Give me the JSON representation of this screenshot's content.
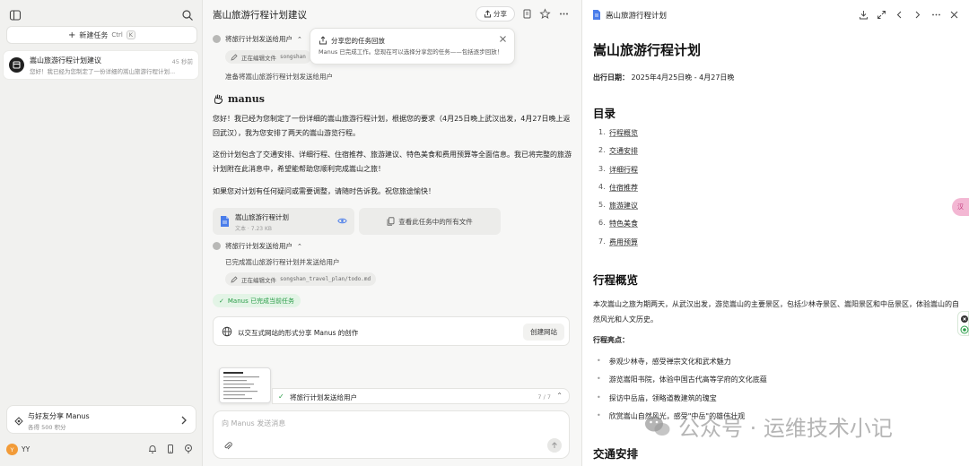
{
  "sidebar": {
    "new_task_label": "新建任务",
    "shortcut_ctrl": "Ctrl",
    "shortcut_key": "K",
    "task": {
      "title": "嵩山旅游行程计划建议",
      "time": "45 秒前",
      "snippet": "您好！我已经为您制定了一份详细的嵩山旅游行程计划..."
    },
    "share": {
      "title": "与好友分享 Manus",
      "subtitle": "各得 500 积分"
    },
    "user": {
      "initial": "Y",
      "name": "YY"
    }
  },
  "chat": {
    "title": "嵩山旅游行程计划建议",
    "share_label": "分享",
    "step1": {
      "label": "将旅行计划发送给用户",
      "chip_prefix": "正在编辑文件",
      "chip_path": "songshan",
      "note": "准备将嵩山旅游行程计划发送给用户"
    },
    "notification": {
      "title": "分享您的任务回放",
      "body": "Manus 已完成工作。您现在可以选择分享您的任务——包括逐步回放！"
    },
    "brand": "manus",
    "paragraphs": [
      "您好！我已经为您制定了一份详细的嵩山旅游行程计划，根据您的要求（4月25日晚上武汉出发，4月27日晚上返回武汉），我为您安排了两天的嵩山游览行程。",
      "这份计划包含了交通安排、详细行程、住宿推荐、旅游建议、特色美食和费用预算等全面信息。我已将完整的旅游计划附在此消息中，希望能帮助您顺利完成嵩山之旅！",
      "如果您对计划有任何疑问或需要调整，请随时告诉我。祝您旅途愉快！"
    ],
    "file": {
      "name": "嵩山旅游行程计划",
      "meta": "文本 · 7.23 KB"
    },
    "view_all_label": "查看此任务中的所有文件",
    "step2": {
      "label": "将旅行计划发送给用户",
      "note": "已完成嵩山旅游行程计划并发送给用户",
      "chip_prefix": "正在编辑文件",
      "chip_path": "songshan_travel_plan/todo.md"
    },
    "complete_label": "Manus 已完成当前任务",
    "web_card": {
      "text": "以交互式网站的形式分享 Manus 的创作",
      "button": "创建网站"
    },
    "progress": {
      "label": "将旅行计划发送给用户",
      "count": "7 / 7"
    },
    "input_placeholder": "向 Manus 发送消息"
  },
  "doc": {
    "header_title": "嵩山旅游行程计划",
    "h1": "嵩山旅游行程计划",
    "date_label": "出行日期：",
    "date_value": "2025年4月25日晚 - 4月27日晚",
    "toc_title": "目录",
    "toc": [
      {
        "num": "1.",
        "label": "行程概览"
      },
      {
        "num": "2.",
        "label": "交通安排"
      },
      {
        "num": "3.",
        "label": "详细行程"
      },
      {
        "num": "4.",
        "label": "住宿推荐"
      },
      {
        "num": "5.",
        "label": "旅游建议"
      },
      {
        "num": "6.",
        "label": "特色美食"
      },
      {
        "num": "7.",
        "label": "费用预算"
      }
    ],
    "overview_title": "行程概览",
    "overview_text": "本次嵩山之旅为期两天，从武汉出发，游览嵩山的主要景区，包括少林寺景区、嵩阳景区和中岳景区，体验嵩山的自然风光和人文历史。",
    "highlights_title": "行程亮点：",
    "highlights": [
      "参观少林寺，感受禅宗文化和武术魅力",
      "游览嵩阳书院，体验中国古代高等学府的文化底蕴",
      "探访中岳庙，领略道教建筑的瑰宝",
      "欣赏嵩山自然风光，感受\"中岳\"的雄伟壮观"
    ],
    "transport_title": "交通安排"
  },
  "side_tab_label": "汉",
  "watermark": "公众号 · 运维技术小记"
}
